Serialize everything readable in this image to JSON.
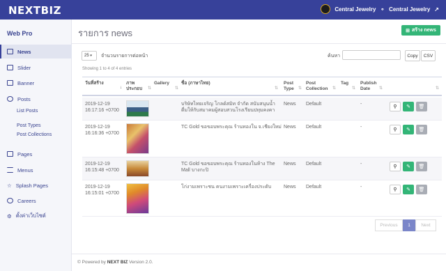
{
  "topbar": {
    "logo": "NEXTBIZ",
    "org_name": "Central Jewelry",
    "user_name": "Central Jewelry"
  },
  "sidebar": {
    "brand": "Web Pro",
    "items": [
      {
        "label": "News",
        "icon": "list-icon"
      },
      {
        "label": "Slider",
        "icon": "image-icon"
      },
      {
        "label": "Banner",
        "icon": "table-icon"
      },
      {
        "label": "Posts",
        "icon": "pin-icon"
      },
      {
        "label": "Pages",
        "icon": "monitor-icon"
      },
      {
        "label": "Menus",
        "icon": "menu-icon"
      },
      {
        "label": "Splash Pages",
        "icon": "star-icon"
      },
      {
        "label": "Careers",
        "icon": "users-icon"
      },
      {
        "label": "ตั้งค่าเว็บไซต์",
        "icon": "gear-icon"
      }
    ],
    "post_sub": [
      "List Posts",
      "Post Types",
      "Post Collections"
    ]
  },
  "main": {
    "title": "รายการ news",
    "create_label": "สร้าง news",
    "page_size": "25",
    "page_size_label": "จำนวนรายการต่อหน้า",
    "search_label": "ค้นหา",
    "copy_label": "Copy",
    "csv_label": "CSV",
    "info": "Showing 1 to 4 of 4 entries",
    "columns": [
      "วันที่สร้าง",
      "ภาพประกอบ",
      "Gallery",
      "ชื่อ (ภาษาไทย)",
      "Post Type",
      "Post Collection",
      "Tag",
      "Publish Date"
    ],
    "rows": [
      {
        "date": "2019-12-19",
        "time": "16:17:16 +0700",
        "title1": "บริษัทไทยเจริญ โกลด์สมิท จำกัด สนับสนุนน้ำ",
        "title2": "ดื่มให้กับสมาคมผู้สอบสวนโรงเรียนปทุมคงคา",
        "type": "News",
        "collection": "Default",
        "publish": "-"
      },
      {
        "date": "2019-12-19",
        "time": "16:16:36 +0700",
        "title1": "TC Gold ขอขอบพระคุณ ร้านทองใน จ.เชียงใหม่",
        "title2": "",
        "type": "News",
        "collection": "Default",
        "publish": "-"
      },
      {
        "date": "2019-12-19",
        "time": "16:15:48 +0700",
        "title1": "TC Gold ขอขอบพระคุณ ร้านทองในห้าง The",
        "title2": "Mall บางกะปิ",
        "type": "News",
        "collection": "Default",
        "publish": "-"
      },
      {
        "date": "2019-12-19",
        "time": "16:15:01 +0700",
        "title1": "โก่งามเพราะชน คนงามเพราะเครื่องประดับ",
        "title2": "",
        "type": "News",
        "collection": "Default",
        "publish": "-"
      }
    ],
    "pager": {
      "prev": "Previous",
      "page": "1",
      "next": "Next"
    },
    "footer_pre": "© Powered by",
    "footer_brand": "NEXT BIZ",
    "footer_post": "Version 2.0."
  },
  "colors": {
    "primary": "#37419a",
    "success": "#33b577",
    "gray": "#a9adb5"
  }
}
